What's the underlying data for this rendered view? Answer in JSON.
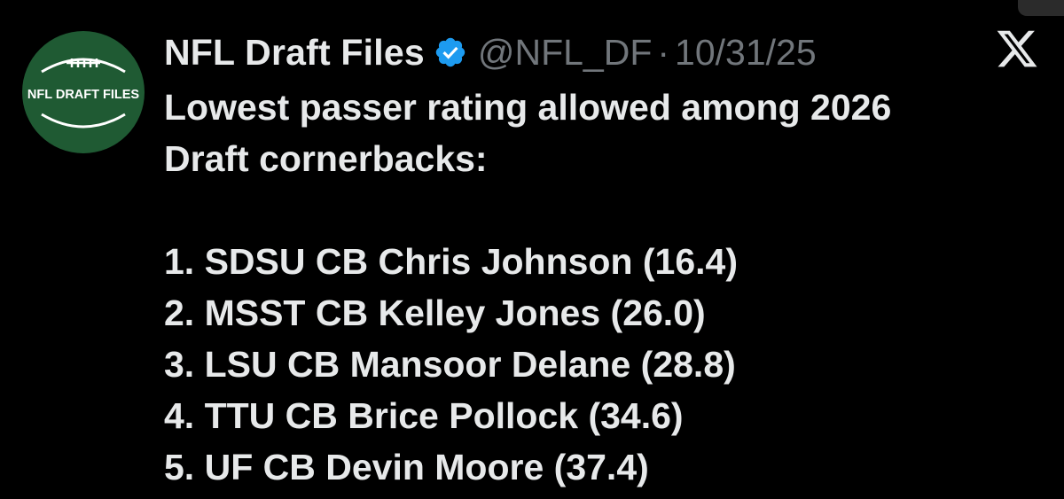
{
  "account": {
    "display_name": "NFL Draft Files",
    "handle": "@NFL_DF",
    "separator": "·",
    "date": "10/31/25",
    "avatar_text": "NFL DRAFT FILES"
  },
  "post": {
    "text_lines": [
      "Lowest passer rating allowed among 2026",
      "Draft cornerbacks:"
    ],
    "list": [
      "1. SDSU CB Chris Johnson (16.4)",
      "2. MSST CB Kelley Jones (26.0)",
      "3. LSU CB Mansoor Delane (28.8)",
      "4. TTU CB Brice Pollock (34.6)",
      "5. UF CB Devin Moore (37.4)"
    ]
  },
  "icons": {
    "verified": "verified-badge-icon",
    "platform": "x-logo-icon"
  },
  "colors": {
    "background": "#000000",
    "text": "#e7e9ea",
    "muted": "#71767b",
    "verified": "#1d9bf0",
    "avatar_bg": "#1f5a33"
  }
}
